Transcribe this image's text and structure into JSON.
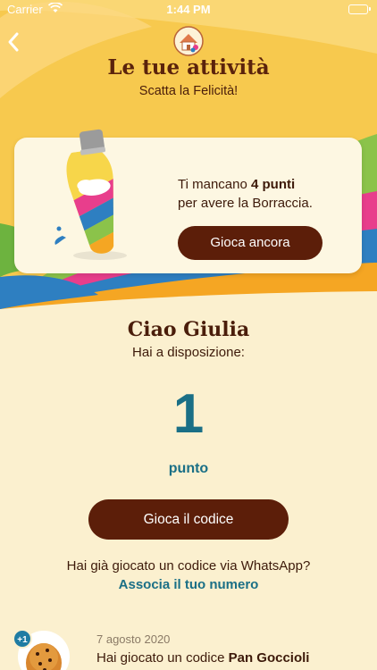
{
  "status_bar": {
    "carrier": "Carrier",
    "time": "1:44 PM"
  },
  "header": {
    "title": "Le tue attività",
    "subtitle": "Scatta la Felicità!"
  },
  "promo_card": {
    "text_before": "Ti mancano ",
    "points_missing": "4 punti",
    "text_after": "per avere la Borraccia.",
    "button_label": "Gioca ancora"
  },
  "summary": {
    "greeting": "Ciao Giulia",
    "available_label": "Hai a disposizione:",
    "points_value": "1",
    "points_unit": "punto",
    "play_code_button": "Gioca il codice",
    "whatsapp_question": "Hai già giocato un codice via WhatsApp?",
    "whatsapp_link": "Associa il tuo numero"
  },
  "activity": {
    "badge": "+1",
    "date": "7 agosto 2020",
    "text_prefix": "Hai giocato un codice ",
    "product": "Pan Goccioli"
  },
  "colors": {
    "brown": "#5C1E09",
    "teal": "#1A6F86",
    "cream": "#FBF0CF",
    "yellow": "#F7CF57"
  },
  "icons": [
    "wifi-icon",
    "battery-icon",
    "chevron-left-icon",
    "brand-logo-icon",
    "bottle-image",
    "cookie-image"
  ]
}
